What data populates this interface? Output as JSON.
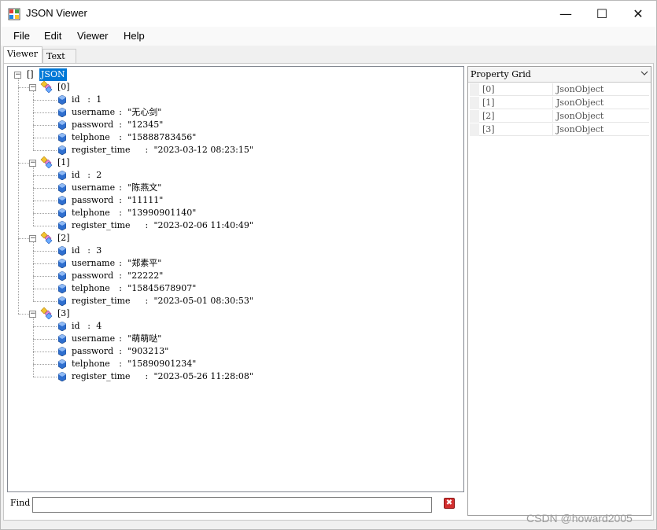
{
  "window": {
    "title": "JSON Viewer",
    "minimize": "—",
    "maximize": "☐",
    "close": "✕"
  },
  "menu": [
    "File",
    "Edit",
    "Viewer",
    "Help"
  ],
  "tabs": [
    {
      "label": "Viewer",
      "active": true
    },
    {
      "label": "Text",
      "active": false
    }
  ],
  "tree": {
    "root_bracket": "[]",
    "root_label": "JSON",
    "items": [
      {
        "index": "[0]",
        "fields": [
          {
            "key": "id",
            "value": "1"
          },
          {
            "key": "username",
            "value": "\"无心剑\""
          },
          {
            "key": "password",
            "value": "\"12345\""
          },
          {
            "key": "telphone",
            "value": "\"15888783456\""
          },
          {
            "key": "register_time",
            "value": "\"2023-03-12 08:23:15\""
          }
        ]
      },
      {
        "index": "[1]",
        "fields": [
          {
            "key": "id",
            "value": "2"
          },
          {
            "key": "username",
            "value": "\"陈燕文\""
          },
          {
            "key": "password",
            "value": "\"11111\""
          },
          {
            "key": "telphone",
            "value": "\"13990901140\""
          },
          {
            "key": "register_time",
            "value": "\"2023-02-06 11:40:49\""
          }
        ]
      },
      {
        "index": "[2]",
        "fields": [
          {
            "key": "id",
            "value": "3"
          },
          {
            "key": "username",
            "value": "\"郑素平\""
          },
          {
            "key": "password",
            "value": "\"22222\""
          },
          {
            "key": "telphone",
            "value": "\"15845678907\""
          },
          {
            "key": "register_time",
            "value": "\"2023-05-01 08:30:53\""
          }
        ]
      },
      {
        "index": "[3]",
        "fields": [
          {
            "key": "id",
            "value": "4"
          },
          {
            "key": "username",
            "value": "\"萌萌哒\""
          },
          {
            "key": "password",
            "value": "\"903213\""
          },
          {
            "key": "telphone",
            "value": "\"15890901234\""
          },
          {
            "key": "register_time",
            "value": "\"2023-05-26 11:28:08\""
          }
        ]
      }
    ]
  },
  "find": {
    "label": "Find",
    "value": "",
    "clear_icon": "✖"
  },
  "property_grid": {
    "title": "Property Grid",
    "dropdown_icon": "chevron-down-icon",
    "rows": [
      {
        "name": "[0]",
        "value": "JsonObject"
      },
      {
        "name": "[1]",
        "value": "JsonObject"
      },
      {
        "name": "[2]",
        "value": "JsonObject"
      },
      {
        "name": "[3]",
        "value": "JsonObject"
      }
    ]
  },
  "watermark": "CSDN @howard2005",
  "colors": {
    "selection": "#0078d7",
    "clear_button": "#d32f2f",
    "leaf_icon": "#1f5fbf"
  }
}
